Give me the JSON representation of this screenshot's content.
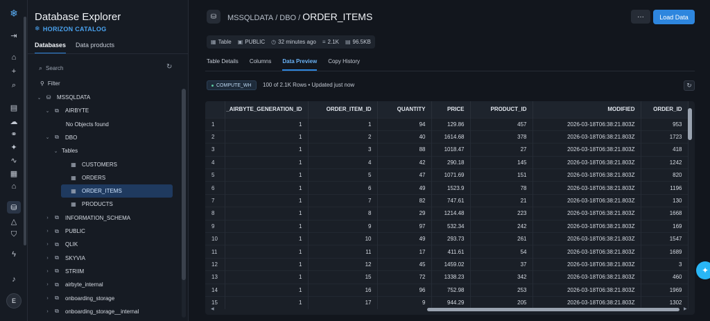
{
  "rail": {
    "icons": [
      "snowflake-icon",
      "collapse-icon",
      "home-icon",
      "plus-icon",
      "search-icon",
      "notebook-icon",
      "upload-icon",
      "workflow-icon",
      "ai-icon",
      "activity-icon",
      "apps-icon",
      "marketplace-icon",
      "database-icon",
      "governance-icon",
      "shield-icon",
      "bolt-icon",
      "bell-icon"
    ],
    "avatar_initial": "E"
  },
  "explorer": {
    "title": "Database Explorer",
    "subtitle": "HORIZON CATALOG",
    "tabs": [
      {
        "label": "Databases",
        "active": true
      },
      {
        "label": "Data products",
        "active": false
      }
    ],
    "search_placeholder": "Search",
    "filter_label": "Filter",
    "tree": [
      {
        "label": "MSSQLDATA",
        "level": 0,
        "chevron": "down",
        "icon": "database-icon"
      },
      {
        "label": "AIRBYTE",
        "level": 1,
        "chevron": "down",
        "icon": "schema-icon"
      },
      {
        "label": "No Objects found",
        "level": 2,
        "chevron": "",
        "icon": ""
      },
      {
        "label": "DBO",
        "level": 1,
        "chevron": "down",
        "icon": "schema-icon"
      },
      {
        "label": "Tables",
        "level": 2,
        "chevron": "down",
        "icon": ""
      },
      {
        "label": "CUSTOMERS",
        "level": 3,
        "chevron": "",
        "icon": "table-icon"
      },
      {
        "label": "ORDERS",
        "level": 3,
        "chevron": "",
        "icon": "table-icon"
      },
      {
        "label": "ORDER_ITEMS",
        "level": 3,
        "chevron": "",
        "icon": "table-icon",
        "selected": true
      },
      {
        "label": "PRODUCTS",
        "level": 3,
        "chevron": "",
        "icon": "table-icon"
      },
      {
        "label": "INFORMATION_SCHEMA",
        "level": 1,
        "chevron": "right",
        "icon": "schema-icon"
      },
      {
        "label": "PUBLIC",
        "level": 1,
        "chevron": "right",
        "icon": "schema-icon"
      },
      {
        "label": "QLIK",
        "level": 1,
        "chevron": "right",
        "icon": "schema-icon"
      },
      {
        "label": "SKYVIA",
        "level": 1,
        "chevron": "right",
        "icon": "schema-icon"
      },
      {
        "label": "STRIIM",
        "level": 1,
        "chevron": "right",
        "icon": "schema-icon"
      },
      {
        "label": "airbyte_internal",
        "level": 1,
        "chevron": "right",
        "icon": "schema-icon"
      },
      {
        "label": "onboarding_storage",
        "level": 1,
        "chevron": "right",
        "icon": "schema-icon"
      },
      {
        "label": "onboarding_storage__internal",
        "level": 1,
        "chevron": "right",
        "icon": "schema-icon"
      }
    ]
  },
  "main": {
    "breadcrumb": {
      "db": "MSSQLDATA",
      "sep1": "/",
      "schema": "DBO",
      "sep2": "/",
      "current": "ORDER_ITEMS"
    },
    "more_label": "···",
    "load_label": "Load Data",
    "meta": [
      {
        "icon": "table-icon",
        "text": "Table"
      },
      {
        "icon": "owner-icon",
        "text": "PUBLIC"
      },
      {
        "icon": "clock-icon",
        "text": "32 minutes ago"
      },
      {
        "icon": "rows-icon",
        "text": "2.1K"
      },
      {
        "icon": "storage-icon",
        "text": "96.5KB"
      }
    ],
    "tabs": [
      {
        "label": "Table Details",
        "active": false
      },
      {
        "label": "Columns",
        "active": false
      },
      {
        "label": "Data Preview",
        "active": true
      },
      {
        "label": "Copy History",
        "active": false
      }
    ],
    "warehouse": "COMPUTE_WH",
    "row_info": "100 of 2.1K Rows • Updated just now",
    "table": {
      "columns": [
        "",
        "_AIRBYTE_GENERATION_ID",
        "ORDER_ITEM_ID",
        "QUANTITY",
        "PRICE",
        "PRODUCT_ID",
        "MODIFIED",
        "ORDER_ID"
      ],
      "rows": [
        [
          "1",
          "1",
          "1",
          "94",
          "129.86",
          "457",
          "2026-03-18T06:38:21.803Z",
          "953"
        ],
        [
          "2",
          "1",
          "2",
          "40",
          "1614.68",
          "378",
          "2026-03-18T06:38:21.803Z",
          "1723"
        ],
        [
          "3",
          "1",
          "3",
          "88",
          "1018.47",
          "27",
          "2026-03-18T06:38:21.803Z",
          "418"
        ],
        [
          "4",
          "1",
          "4",
          "42",
          "290.18",
          "145",
          "2026-03-18T06:38:21.803Z",
          "1242"
        ],
        [
          "5",
          "1",
          "5",
          "47",
          "1071.69",
          "151",
          "2026-03-18T06:38:21.803Z",
          "820"
        ],
        [
          "6",
          "1",
          "6",
          "49",
          "1523.9",
          "78",
          "2026-03-18T06:38:21.803Z",
          "1196"
        ],
        [
          "7",
          "1",
          "7",
          "82",
          "747.61",
          "21",
          "2026-03-18T06:38:21.803Z",
          "130"
        ],
        [
          "8",
          "1",
          "8",
          "29",
          "1214.48",
          "223",
          "2026-03-18T06:38:21.803Z",
          "1668"
        ],
        [
          "9",
          "1",
          "9",
          "97",
          "532.34",
          "242",
          "2026-03-18T06:38:21.803Z",
          "169"
        ],
        [
          "10",
          "1",
          "10",
          "49",
          "293.73",
          "261",
          "2026-03-18T06:38:21.803Z",
          "1547"
        ],
        [
          "11",
          "1",
          "11",
          "17",
          "411.61",
          "54",
          "2026-03-18T06:38:21.803Z",
          "1689"
        ],
        [
          "12",
          "1",
          "12",
          "45",
          "1459.02",
          "37",
          "2026-03-18T06:38:21.803Z",
          "3"
        ],
        [
          "13",
          "1",
          "15",
          "72",
          "1338.23",
          "342",
          "2026-03-18T06:38:21.803Z",
          "460"
        ],
        [
          "14",
          "1",
          "16",
          "96",
          "752.98",
          "253",
          "2026-03-18T06:38:21.803Z",
          "1969"
        ],
        [
          "15",
          "1",
          "17",
          "9",
          "944.29",
          "205",
          "2026-03-18T06:38:21.803Z",
          "1302"
        ]
      ]
    }
  },
  "colors": {
    "accent": "#2e86de",
    "selected": "#1f3a5f",
    "fab": "#29b6f6"
  }
}
